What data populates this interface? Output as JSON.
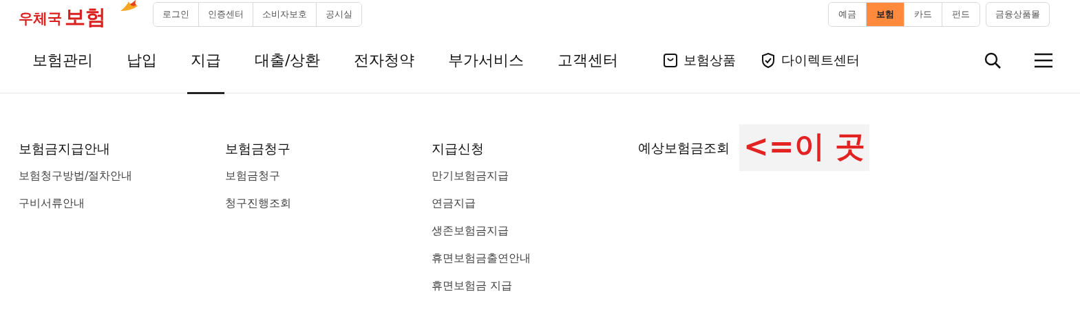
{
  "logo": {
    "text_small": "우체국",
    "text_large": "보험"
  },
  "util_links": [
    "로그인",
    "인증센터",
    "소비자보호",
    "공시실"
  ],
  "site_tabs": [
    {
      "label": "예금",
      "selected": false
    },
    {
      "label": "보험",
      "selected": true
    },
    {
      "label": "카드",
      "selected": false
    },
    {
      "label": "펀드",
      "selected": false
    }
  ],
  "mall_button": "금융상품몰",
  "main_nav": [
    {
      "label": "보험관리",
      "selected": false
    },
    {
      "label": "납입",
      "selected": false
    },
    {
      "label": "지급",
      "selected": true
    },
    {
      "label": "대출/상환",
      "selected": false
    },
    {
      "label": "전자청약",
      "selected": false
    },
    {
      "label": "부가서비스",
      "selected": false
    },
    {
      "label": "고객센터",
      "selected": false
    }
  ],
  "nav_extras": [
    {
      "label": "보험상품",
      "kind": "bag"
    },
    {
      "label": "다이렉트센터",
      "kind": "shield"
    }
  ],
  "mega_menu": [
    {
      "heading": "보험금지급안내",
      "items": [
        "보험청구방법/절차안내",
        "구비서류안내"
      ]
    },
    {
      "heading": "보험금청구",
      "items": [
        "보험금청구",
        "청구진행조회"
      ]
    },
    {
      "heading": "지급신청",
      "items": [
        "만기보험금지급",
        "연금지급",
        "생존보험금지급",
        "휴면보험금출연안내",
        "휴면보험금 지급"
      ]
    },
    {
      "heading": "예상보험금조회",
      "annotation": "<=이 곳"
    }
  ]
}
